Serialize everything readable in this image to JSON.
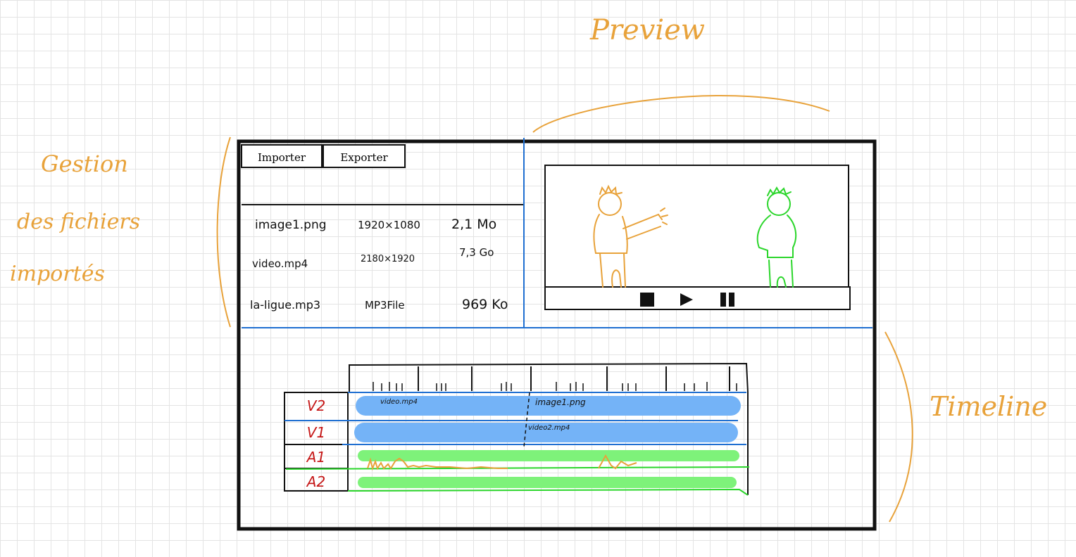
{
  "annotations": {
    "file_section": [
      "Gestion",
      "des fichiers",
      "importés"
    ],
    "preview": "Preview",
    "timeline": "Timeline"
  },
  "toolbar": {
    "import_label": "Importer",
    "export_label": "Exporter"
  },
  "files": [
    {
      "name": "image1.png",
      "resolution": "1920×1080",
      "size": "2,1 Mo"
    },
    {
      "name": "video.mp4",
      "resolution": "2180×1920",
      "size": "7,3 Go"
    },
    {
      "name": "la-ligue.mp3",
      "resolution": "MP3File",
      "size": "969 Ko"
    }
  ],
  "player": {
    "stop_icon": "stop-icon",
    "play_icon": "play-icon",
    "pause_icon": "pause-icon"
  },
  "tracks": [
    {
      "label": "V2",
      "clips": [
        "video.mp4",
        "image1.png"
      ]
    },
    {
      "label": "V1",
      "clips": [
        "video2.mp4"
      ]
    },
    {
      "label": "A1",
      "clips": []
    },
    {
      "label": "A2",
      "clips": []
    }
  ],
  "colors": {
    "annotation": "#e8a23a",
    "panel_divider": "#1f6fd1",
    "video_clip": "#74b3f7",
    "audio_clip": "#7ef27a",
    "track_label": "#c51616",
    "character_left": "#e8a23a",
    "character_right": "#2bd62b"
  }
}
